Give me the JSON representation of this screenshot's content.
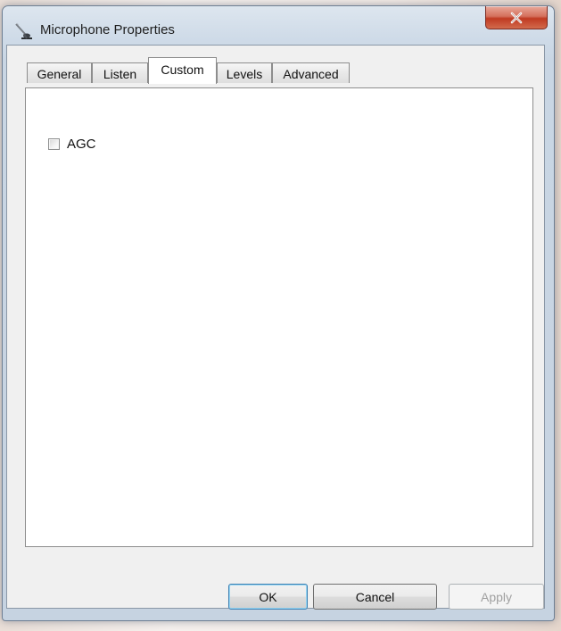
{
  "window": {
    "title": "Microphone Properties",
    "icon": "microphone-icon",
    "close_icon": "close-icon",
    "close_glyph": "x"
  },
  "tabs": [
    {
      "label": "General",
      "active": false
    },
    {
      "label": "Listen",
      "active": false
    },
    {
      "label": "Custom",
      "active": true
    },
    {
      "label": "Levels",
      "active": false
    },
    {
      "label": "Advanced",
      "active": false
    }
  ],
  "custom": {
    "agc": {
      "label": "AGC",
      "checked": false
    }
  },
  "buttons": {
    "ok": "OK",
    "cancel": "Cancel",
    "apply": "Apply",
    "apply_enabled": false
  },
  "colors": {
    "close_button": "#c03a22",
    "default_button_border": "#3c7fb1"
  }
}
